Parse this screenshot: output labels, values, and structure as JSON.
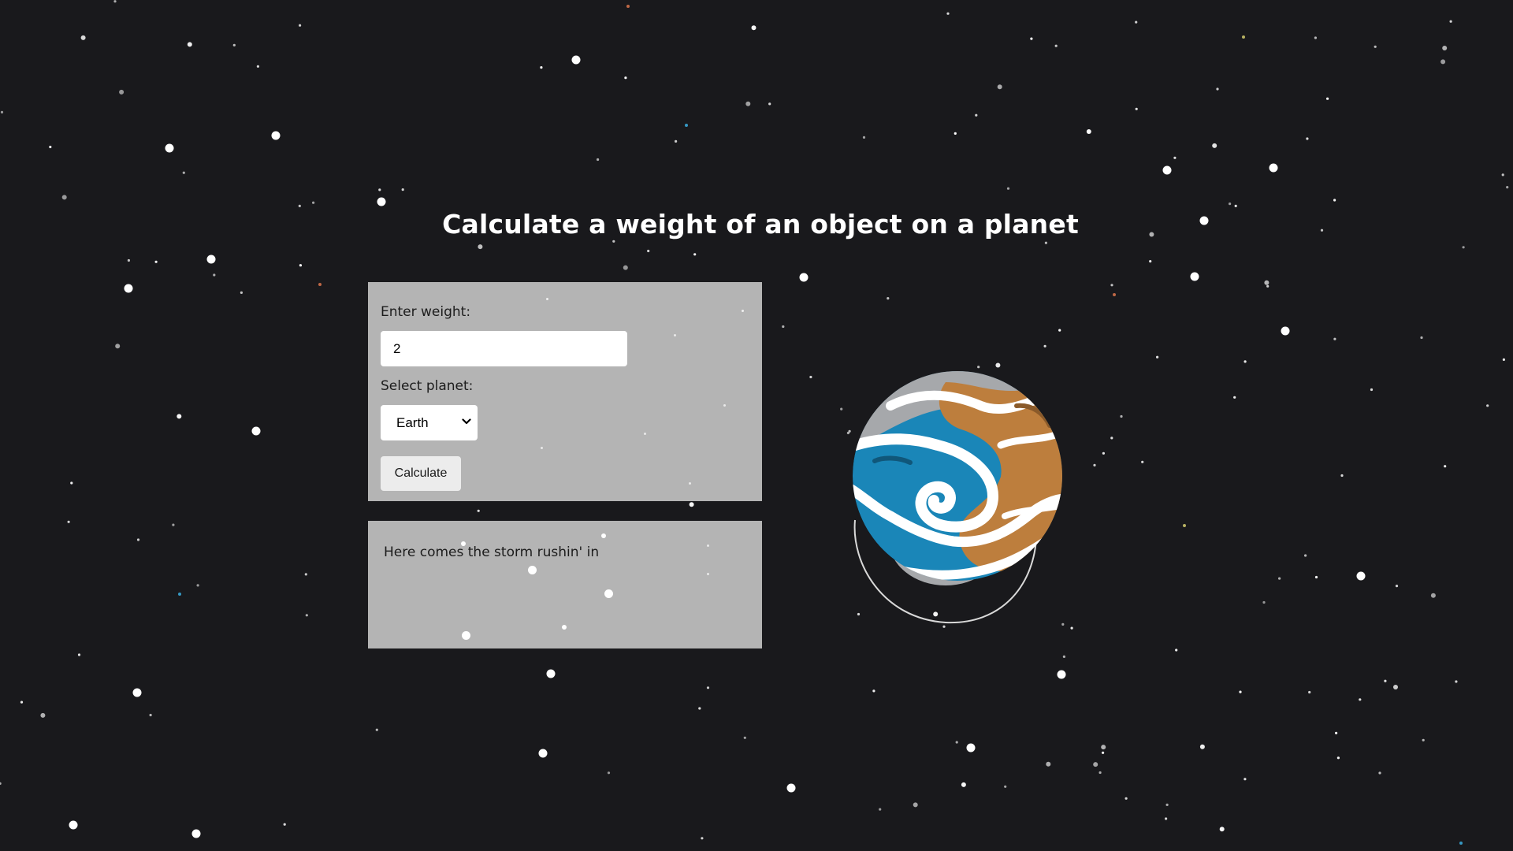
{
  "page": {
    "title": "Calculate a weight of an object on a planet"
  },
  "form": {
    "weight_label": "Enter weight:",
    "weight_value": "2",
    "planet_label": "Select planet:",
    "planet_selected": "Earth",
    "calculate_label": "Calculate"
  },
  "result": {
    "text": "Here comes the storm rushin' in"
  },
  "planet_illustration": {
    "icon": "planet-icon",
    "colors": {
      "ocean": "#1a86b8",
      "land": "#bd7e3d",
      "cloud": "#ffffff",
      "shadow": "#a6a8ab"
    }
  },
  "colors": {
    "background": "#19191c",
    "panel": "#b4b4b4",
    "title": "#ffffff"
  }
}
